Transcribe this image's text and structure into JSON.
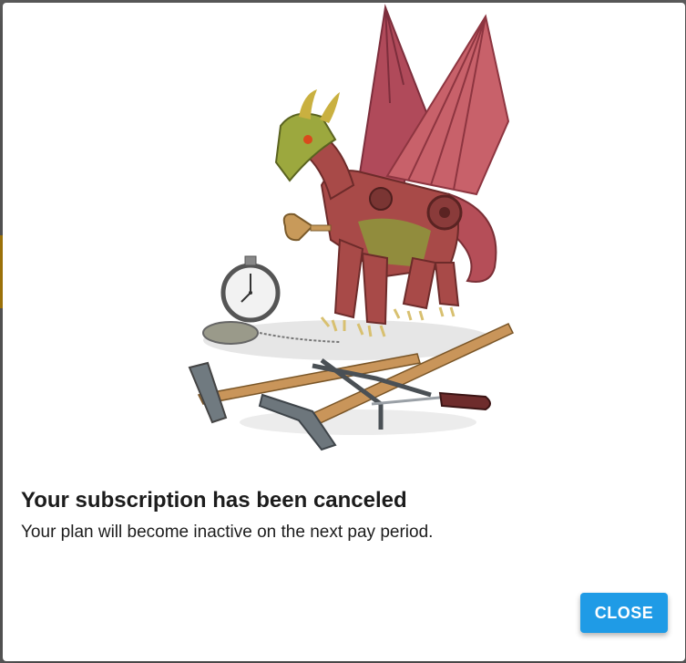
{
  "dialog": {
    "title": "Your subscription has been canceled",
    "message": "Your plan will become inactive on the next pay period.",
    "close_label": "CLOSE"
  },
  "illustration": {
    "subject": "mechanical-dragon-with-tools-illustration"
  },
  "colors": {
    "button": "#1f9be6",
    "button_text": "#ffffff",
    "text": "#1c1c1c",
    "dragon_wing": "#b8555c",
    "dragon_body": "#a84a48",
    "dragon_accent": "#8aa33a"
  }
}
